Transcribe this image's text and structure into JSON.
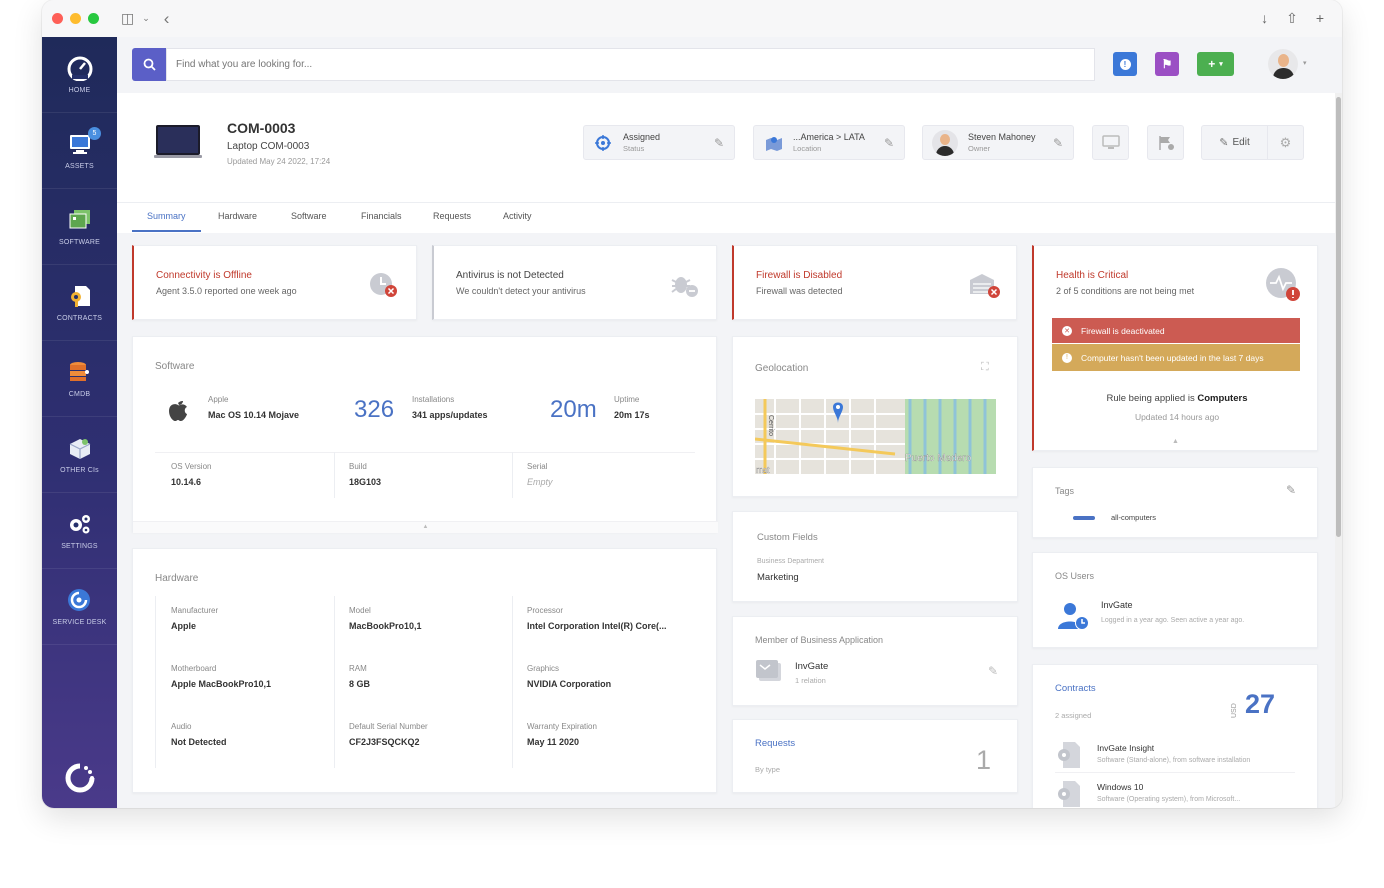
{
  "search": {
    "placeholder": "Find what you are looking for..."
  },
  "sidebar": {
    "items": [
      {
        "label": "HOME",
        "icon": "gauge-icon"
      },
      {
        "label": "ASSETS",
        "icon": "monitor-icon",
        "badge": "5"
      },
      {
        "label": "SOFTWARE",
        "icon": "software-icon"
      },
      {
        "label": "CONTRACTS",
        "icon": "contract-icon"
      },
      {
        "label": "CMDB",
        "icon": "database-icon"
      },
      {
        "label": "OTHER CIs",
        "icon": "box-icon"
      },
      {
        "label": "SETTINGS",
        "icon": "gears-icon"
      },
      {
        "label": "SERVICE DESK",
        "icon": "service-desk-icon"
      }
    ]
  },
  "asset": {
    "code": "COM-0003",
    "name": "Laptop COM-0003",
    "updated": "Updated May 24 2022, 17:24"
  },
  "header_cards": {
    "status": {
      "value": "Assigned",
      "label": "Status"
    },
    "location": {
      "value": "...America > LATA",
      "label": "Location"
    },
    "owner": {
      "value": "Steven Mahoney",
      "label": "Owner"
    },
    "edit_label": "Edit"
  },
  "tabs": [
    "Summary",
    "Hardware",
    "Software",
    "Financials",
    "Requests",
    "Activity"
  ],
  "alerts": [
    {
      "title": "Connectivity is Offline",
      "desc": "Agent 3.5.0 reported one week ago",
      "color": "#c0392b"
    },
    {
      "title": "Antivirus is not Detected",
      "desc": "We couldn't detect your antivirus",
      "color": "#444444"
    },
    {
      "title": "Firewall is Disabled",
      "desc": "Firewall was detected",
      "color": "#c0392b"
    },
    {
      "title": "Health is Critical",
      "desc": "2 of 5 conditions are not being met",
      "color": "#c0392b"
    }
  ],
  "health": {
    "conditions": [
      "Firewall is deactivated",
      "Computer hasn't been updated in the last 7 days"
    ],
    "rule_prefix": "Rule being applied is ",
    "rule_target": "Computers",
    "rule_updated": "Updated 14 hours ago"
  },
  "software": {
    "title": "Software",
    "os_vendor": "Apple",
    "os_name": "Mac OS 10.14 Mojave",
    "installations_count": "326",
    "installations_label": "Installations",
    "installations_detail": "341 apps/updates",
    "uptime_big": "20m",
    "uptime_label": "Uptime",
    "uptime_detail": "20m 17s",
    "fields": [
      {
        "label": "OS Version",
        "value": "10.14.6"
      },
      {
        "label": "Build",
        "value": "18G103"
      },
      {
        "label": "Serial",
        "value": "Empty"
      }
    ]
  },
  "hardware": {
    "title": "Hardware",
    "fields": [
      {
        "label": "Manufacturer",
        "value": "Apple"
      },
      {
        "label": "Model",
        "value": "MacBookPro10,1"
      },
      {
        "label": "Processor",
        "value": "Intel Corporation Intel(R) Core(..."
      },
      {
        "label": "Motherboard",
        "value": "Apple MacBookPro10,1"
      },
      {
        "label": "RAM",
        "value": "8 GB"
      },
      {
        "label": "Graphics",
        "value": "NVIDIA Corporation"
      },
      {
        "label": "Audio",
        "value": "Not Detected"
      },
      {
        "label": "Default Serial Number",
        "value": "CF2J3FSQCKQ2"
      },
      {
        "label": "Warranty Expiration",
        "value": "May 11 2020"
      }
    ]
  },
  "geolocation": {
    "title": "Geolocation",
    "map_labels": [
      "Cerrito",
      "Puerto Madero",
      "rrat"
    ]
  },
  "custom_fields": {
    "title": "Custom Fields",
    "field_label": "Business Department",
    "field_value": "Marketing"
  },
  "business_app": {
    "title": "Member of Business Application",
    "name": "InvGate",
    "relation": "1 relation"
  },
  "requests": {
    "title": "Requests",
    "sub": "By type",
    "count": "1"
  },
  "tags": {
    "title": "Tags",
    "items": [
      "all-computers"
    ]
  },
  "os_users": {
    "title": "OS Users",
    "name": "InvGate",
    "detail": "Logged in a year ago. Seen active a year ago."
  },
  "contracts": {
    "title": "Contracts",
    "sub": "2 assigned",
    "currency": "USD",
    "amount": "27",
    "items": [
      {
        "name": "InvGate Insight",
        "detail": "Software (Stand-alone), from software installation"
      },
      {
        "name": "Windows 10",
        "detail": "Software (Operating system), from Microsoft..."
      }
    ]
  },
  "colors": {
    "accent": "#5b5fc7",
    "danger": "#c0392b",
    "warn": "#d4a95a",
    "link": "#4a72c4",
    "sidebar": "#25306a"
  }
}
